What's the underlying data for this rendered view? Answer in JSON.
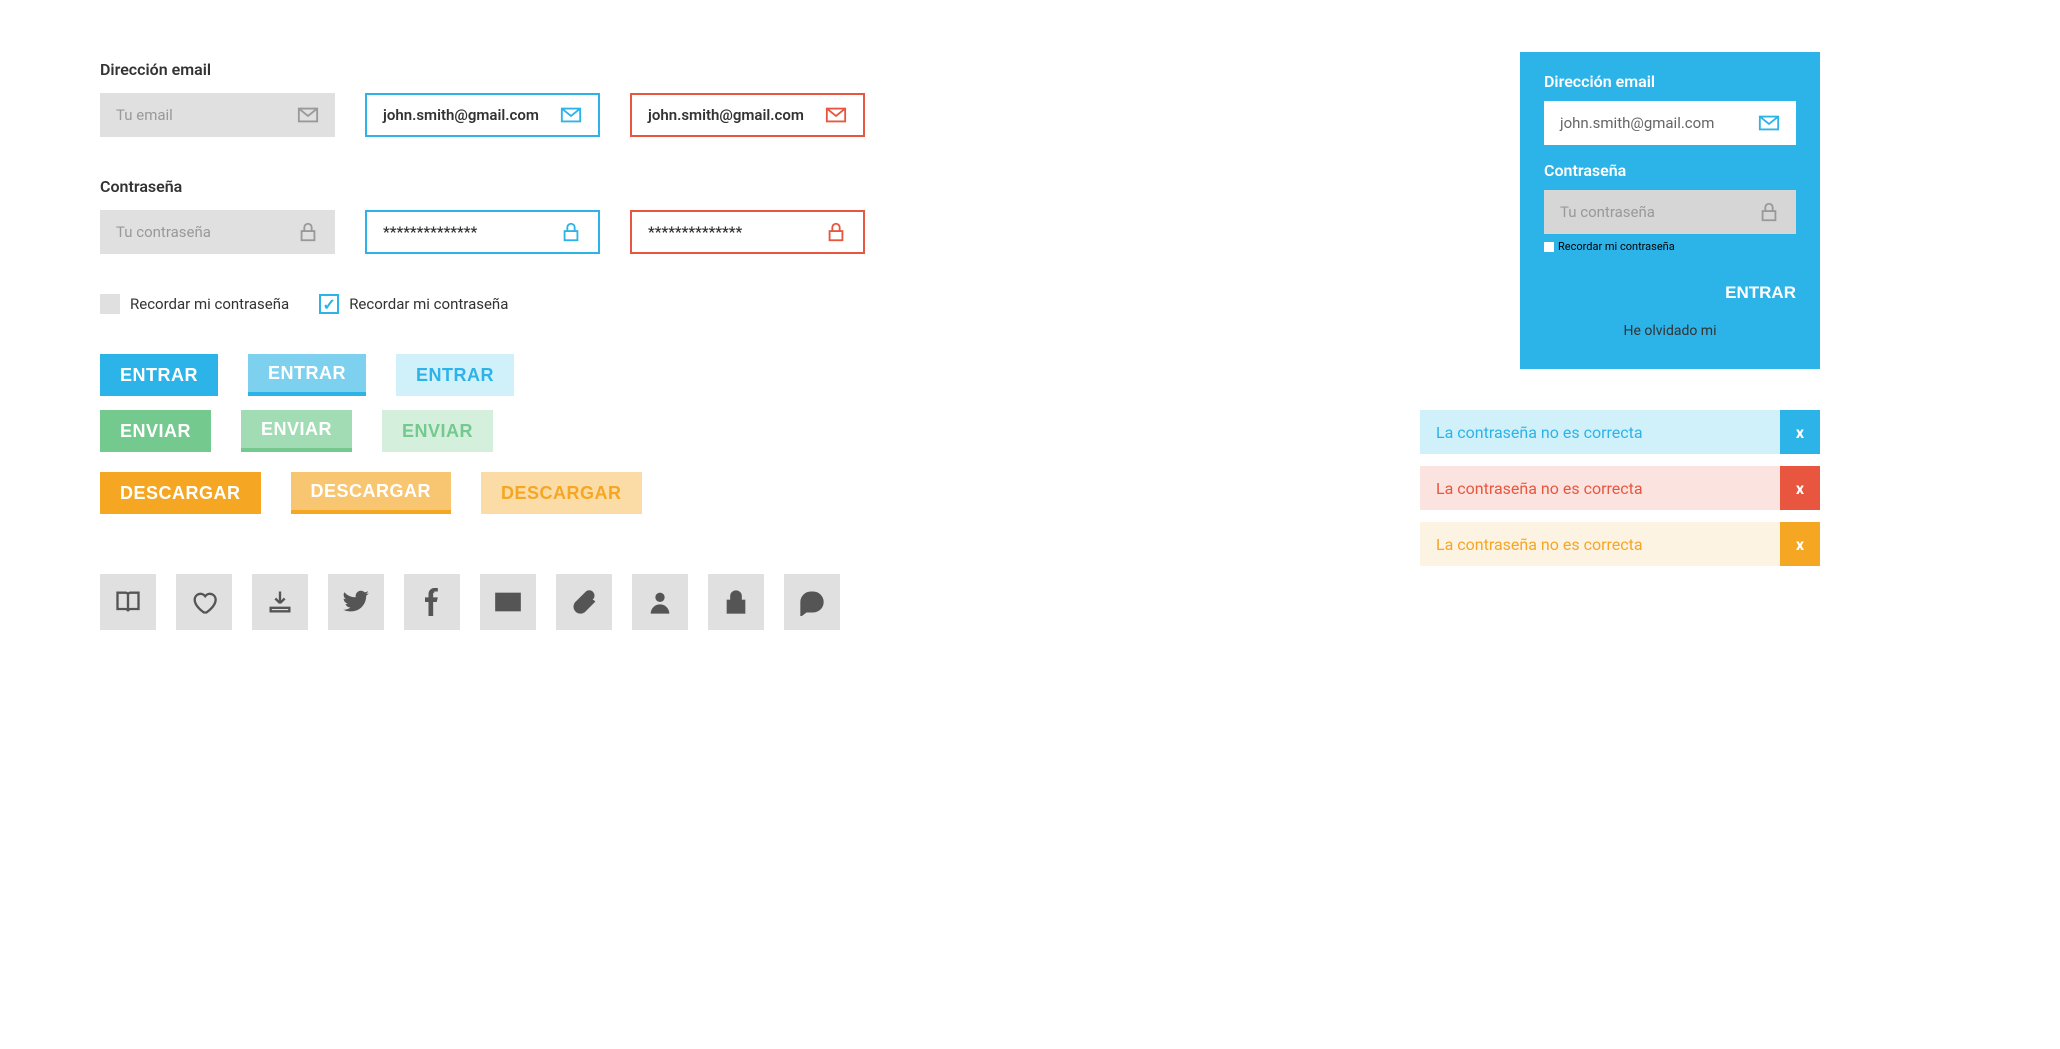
{
  "labels": {
    "email": "Dirección email",
    "password": "Contraseña"
  },
  "placeholders": {
    "email": "Tu email",
    "password": "Tu contraseña"
  },
  "values": {
    "email": "john.smith@gmail.com",
    "password_masked": "**************"
  },
  "checkbox": {
    "label": "Recordar mi contraseña"
  },
  "buttons": {
    "entrar": "ENTRAR",
    "enviar": "ENVIAR",
    "descargar": "DESCARGAR"
  },
  "login_card": {
    "email_label": "Dirección email",
    "email_value": "john.smith@gmail.com",
    "password_label": "Contraseña",
    "password_placeholder": "Tu contraseña",
    "remember": "Recordar mi contraseña",
    "submit": "ENTRAR",
    "forgot": "He olvidado mi"
  },
  "alerts": {
    "msg": "La contraseña no es correcta",
    "close": "x"
  },
  "colors": {
    "blue": "#2cb3e8",
    "red": "#e8563f",
    "green": "#74c98f",
    "orange": "#f5a623",
    "grey": "#e0e0e0"
  },
  "icons": [
    "book",
    "heart",
    "download",
    "twitter",
    "facebook",
    "mail",
    "attachment",
    "user",
    "lock",
    "comment"
  ]
}
